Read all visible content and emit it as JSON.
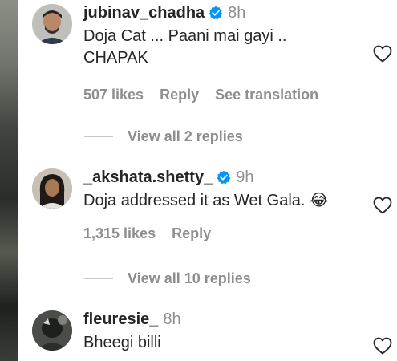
{
  "comments": [
    {
      "username": "jubinav_chadha",
      "verified": true,
      "time": "8h",
      "text_line1": "Doja Cat ... Paani mai gayi ..",
      "text_line2": "CHAPAK",
      "likes": "507 likes",
      "reply": "Reply",
      "see_translation": "See translation",
      "view_replies": "View all 2 replies"
    },
    {
      "username": "_akshata.shetty_",
      "verified": true,
      "time": "9h",
      "text_line1": "Doja addressed it as Wet Gala. 😂",
      "likes": "1,315 likes",
      "reply": "Reply",
      "view_replies": "View all 10 replies"
    },
    {
      "username": "fleuresie_",
      "verified": false,
      "time": "8h",
      "text_line1": "Bheegi billi"
    }
  ],
  "icons": {
    "verified": "verified-badge-icon",
    "like": "heart-outline-icon"
  },
  "colors": {
    "verified_blue": "#0095f6",
    "muted": "#8e8e8e",
    "text": "#262626"
  }
}
